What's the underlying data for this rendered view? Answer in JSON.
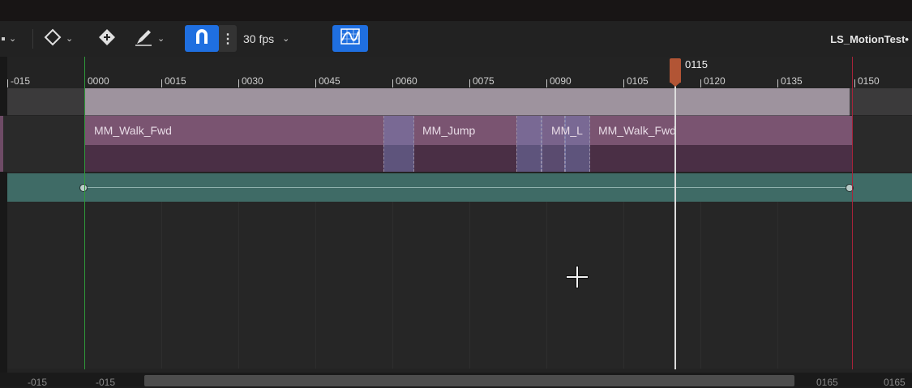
{
  "toolbar": {
    "fps_label": "30 fps",
    "sequence_name": "LS_MotionTest•",
    "icons": [
      "key-diamond-icon",
      "keyframe-add-icon",
      "brush-icon",
      "magnet-snap-icon",
      "more-vertical-icon",
      "curve-editor-icon"
    ]
  },
  "ruler": {
    "ticks": [
      "-015",
      "0000",
      "0015",
      "0030",
      "0045",
      "0060",
      "0075",
      "0090",
      "0105",
      "0120",
      "0135",
      "0150"
    ],
    "playhead_label": "0115"
  },
  "tracks": {
    "animation_clips": [
      "MM_Walk_Fwd",
      "MM_Jump",
      "MM_L",
      "MM_Walk_Fwd"
    ]
  },
  "scroll": {
    "view_start_outer": "-015",
    "view_start_inner": "-015",
    "view_end_inner": "0165",
    "view_end_outer": "0165"
  },
  "colors": {
    "accent": "#1f6fe0",
    "playhead": "#b25535",
    "anim_track": "#7a5471",
    "teal_track": "#3f6b66",
    "start_marker": "#2f9a3a",
    "end_marker": "#a8233a"
  }
}
